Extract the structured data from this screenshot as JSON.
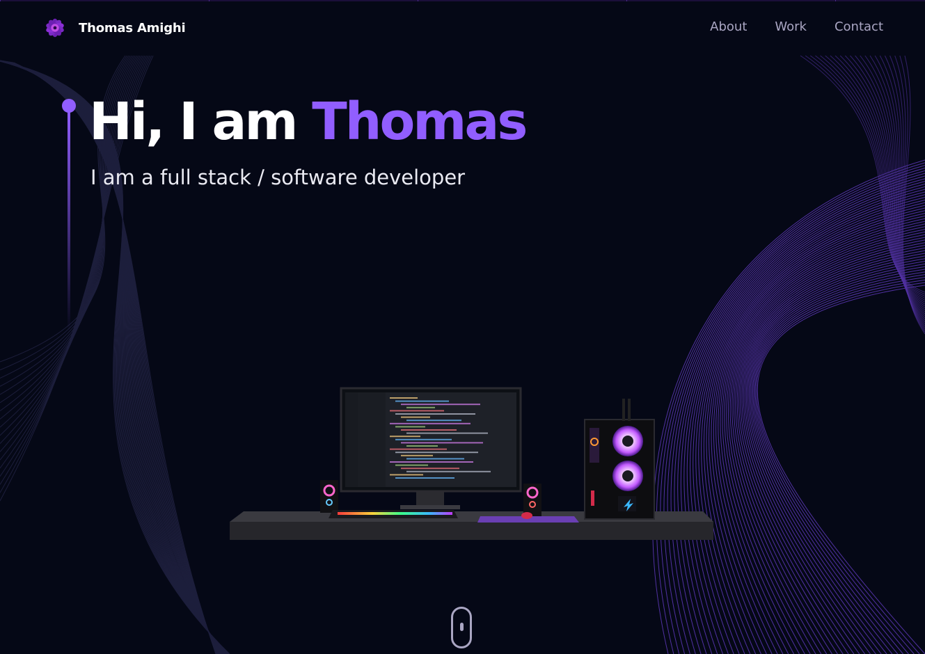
{
  "brand": {
    "name": "Thomas Amighi",
    "logo_icon": "purple-flower-icon"
  },
  "nav": {
    "links": [
      "About",
      "Work",
      "Contact"
    ]
  },
  "hero": {
    "greeting": "Hi, I am ",
    "name": "Thomas",
    "subtitle": "I am a full stack / software developer"
  },
  "scene": {
    "description_icon": "computer-desk-3d-icon"
  },
  "colors": {
    "background": "#050816",
    "accent": "#915eff",
    "nav_text": "#aaa6c3",
    "heading": "#ffffff"
  }
}
